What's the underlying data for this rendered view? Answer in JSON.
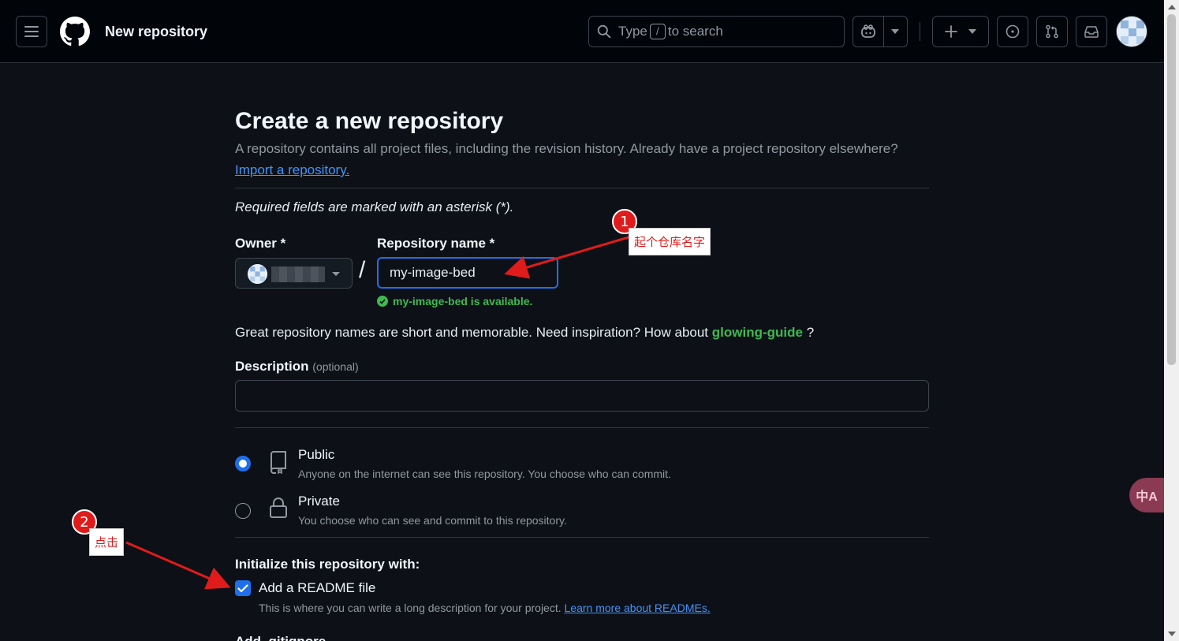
{
  "header": {
    "page_name": "New repository",
    "search": {
      "prefix": "Type",
      "key": "/",
      "suffix": "to search"
    }
  },
  "main": {
    "title": "Create a new repository",
    "subtitle": "A repository contains all project files, including the revision history. Already have a project repository elsewhere?",
    "import_link": "Import a repository.",
    "required_note": "Required fields are marked with an asterisk (*).",
    "owner_label": "Owner *",
    "repo_name_label": "Repository name *",
    "slash": "/",
    "repo_name_value": "my-image-bed",
    "available_msg": "my-image-bed is available.",
    "inspiration": {
      "prefix": "Great repository names are short and memorable. Need inspiration? How about",
      "suggestion": "glowing-guide",
      "suffix": "?"
    },
    "description_label": "Description",
    "description_optional": "(optional)",
    "description_value": "",
    "visibility": {
      "public": {
        "title": "Public",
        "desc": "Anyone on the internet can see this repository. You choose who can commit.",
        "selected": true
      },
      "private": {
        "title": "Private",
        "desc": "You choose who can see and commit to this repository.",
        "selected": false
      }
    },
    "init_title": "Initialize this repository with:",
    "readme": {
      "label": "Add a README file",
      "desc": "This is where you can write a long description for your project.",
      "link": "Learn more about READMEs.",
      "checked": true
    },
    "cutoff_heading": "Add .gitignore"
  },
  "annotations": {
    "badge1": "1",
    "note1": "起个仓库名字",
    "badge2": "2",
    "note2": "点击",
    "color": "#e01b1b"
  },
  "translate_fab": "中A",
  "colors": {
    "accent": "#1f6feb",
    "link": "#4493f8",
    "success": "#3fb950",
    "bg": "#0d1117",
    "header_bg": "#010409"
  }
}
